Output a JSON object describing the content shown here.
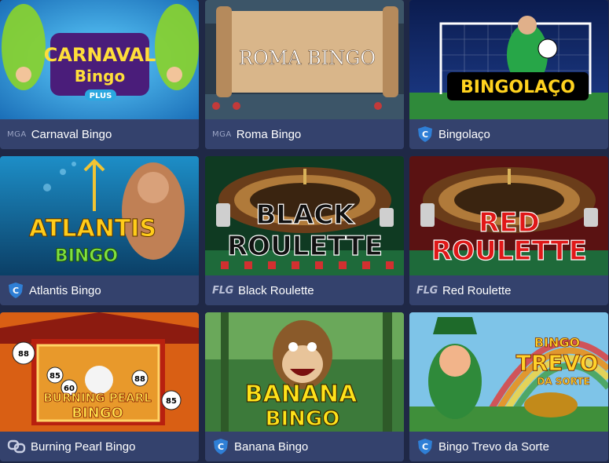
{
  "games": [
    {
      "title": "Carnaval Bingo",
      "provider": "MGA",
      "provider_badge": "mga",
      "art_text": [
        "CARNAVAL",
        "Bingo",
        "PLUS"
      ]
    },
    {
      "title": "Roma Bingo",
      "provider": "MGA",
      "provider_badge": "mga",
      "art_text": [
        "ROMA BINGO"
      ]
    },
    {
      "title": "Bingolaço",
      "provider": "C",
      "provider_badge": "shield-c",
      "art_text": [
        "BINGOLAÇO"
      ]
    },
    {
      "title": "Atlantis Bingo",
      "provider": "C",
      "provider_badge": "shield-c",
      "art_text": [
        "ATLANTIS",
        "BINGO"
      ]
    },
    {
      "title": "Black Roulette",
      "provider": "FLG",
      "provider_badge": "flg",
      "art_text": [
        "BLACK",
        "ROULETTE"
      ]
    },
    {
      "title": "Red Roulette",
      "provider": "FLG",
      "provider_badge": "flg",
      "art_text": [
        "RED",
        "ROULETTE"
      ]
    },
    {
      "title": "Burning Pearl Bingo",
      "provider": "",
      "provider_badge": "link",
      "art_text": [
        "BURNING PEARL",
        "BINGO",
        "88",
        "85",
        "60",
        "88",
        "85"
      ]
    },
    {
      "title": "Banana Bingo",
      "provider": "C",
      "provider_badge": "shield-c",
      "art_text": [
        "BANANA",
        "BINGO"
      ]
    },
    {
      "title": "Bingo Trevo da Sorte",
      "provider": "C",
      "provider_badge": "shield-c",
      "art_text": [
        "BINGO",
        "TREVO",
        "DA SORTE"
      ]
    }
  ],
  "colors": {
    "background": "#1f2846",
    "card": "#34426d",
    "caption_text": "#ffffff",
    "badge_blue": "#2f7fd6"
  }
}
